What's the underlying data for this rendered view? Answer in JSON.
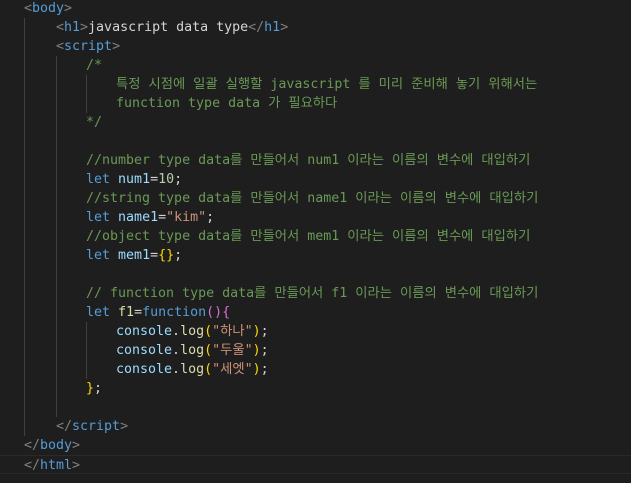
{
  "code": {
    "body_open_lt": "<",
    "body_open_tag": "body",
    "body_open_gt": ">",
    "h1_open": "<",
    "h1_tag": "h1",
    "h1_gt": ">",
    "h1_text": "javascript data type",
    "h1_close_lt": "</",
    "h1_close_tag": "h1",
    "h1_close_gt": ">",
    "script_open_lt": "<",
    "script_tag": "script",
    "script_open_gt": ">",
    "c_open": "/*",
    "c_line1": "특정 시점에 일괄 실행할 javascript 를 미리 준비해 놓기 위해서는",
    "c_line2": "function type data 가 필요하다",
    "c_close": "*/",
    "comment_number": "//number type data를 만들어서 num1 이라는 이름의 변수에 대입하기",
    "let1": "let",
    "num1_name": "num1",
    "num1_eq": "=",
    "num1_val": "10",
    "num1_semi": ";",
    "comment_string": "//string type data를 만들어서 name1 이라는 이름의 변수에 대입하기",
    "let2": "let",
    "name1_name": "name1",
    "name1_eq": "=",
    "name1_val": "\"kim\"",
    "name1_semi": ";",
    "comment_object": "//object type data를 만들어서 mem1 이라는 이름의 변수에 대입하기",
    "let3": "let",
    "mem1_name": "mem1",
    "mem1_eq": "=",
    "mem1_braces": "{}",
    "mem1_semi": ";",
    "comment_function": "// function type data를 만들어서 f1 이라는 이름의 변수에 대입하기",
    "let4": "let",
    "f1_name": "f1",
    "f1_eq": "=",
    "f1_kw": "function",
    "f1_parens": "()",
    "f1_brace_open": "{",
    "log_obj": "console",
    "log_dot": ".",
    "log_fn": "log",
    "log1_str": "\"하나\"",
    "log2_str": "\"두울\"",
    "log3_str": "\"세엣\"",
    "paren_open": "(",
    "paren_close": ")",
    "semi": ";",
    "f1_brace_close": "}",
    "f1_semi": ";",
    "script_close_lt": "</",
    "script_close_tag": "script",
    "script_close_gt": ">",
    "body_close_lt": "</",
    "body_close_tag": "body",
    "body_close_gt": ">",
    "html_close_lt": "</",
    "html_close_tag": "html",
    "html_close_gt": ">"
  }
}
